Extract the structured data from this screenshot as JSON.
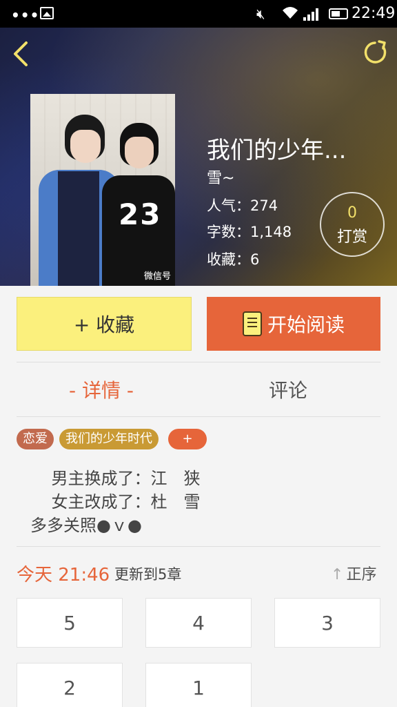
{
  "status_bar": {
    "dots": "•••",
    "time": "22:49"
  },
  "book": {
    "title": "我们的少年...",
    "author": "雪~",
    "popularity": "人气：274",
    "word_count": "字数：1,148",
    "favorites": "收藏：6",
    "cover_watermark": "微信号",
    "cover_number": "23"
  },
  "tip": {
    "count": "0",
    "label": "打赏"
  },
  "actions": {
    "favorite_label": "+ 收藏",
    "read_label": "开始阅读"
  },
  "tabs": {
    "details": "- 详情 -",
    "comments": "评论"
  },
  "tags": [
    "恋爱",
    "我们的少年时代",
    "+"
  ],
  "description": "    男主换成了：江　狭\n    女主改成了：杜　雪\n多多关照●ｖ●",
  "update": {
    "time": "今天 21:46",
    "text": "更新到5章",
    "order_label": "正序"
  },
  "chapters": [
    "5",
    "4",
    "3",
    "2",
    "1"
  ],
  "colors": {
    "accent": "#e6653a",
    "favorite_bg": "#fbf07d"
  }
}
